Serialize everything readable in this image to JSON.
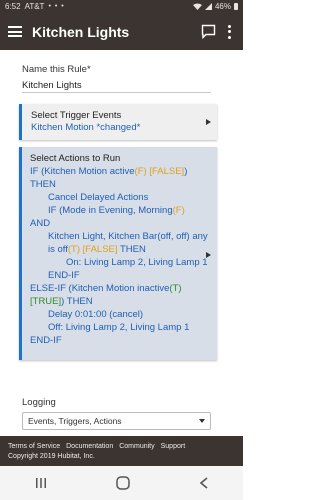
{
  "status_bar": {
    "time": "6:52",
    "carrier": "AT&T",
    "dots": "• • •",
    "battery": "46%"
  },
  "app_bar": {
    "title": "Kitchen Lights"
  },
  "name_field": {
    "label": "Name this Rule*",
    "value": "Kitchen Lights"
  },
  "trigger": {
    "title": "Select Trigger Events",
    "value": "Kitchen Motion *changed*"
  },
  "actions": {
    "title": "Select Actions to Run",
    "l1a": "IF (Kitchen Motion active",
    "l1b": "(F)",
    "l1c": "[FALSE]",
    "l1d": ")",
    "l2": "THEN",
    "l3": "Cancel Delayed Actions",
    "l4a": "IF (Mode in Evening, Morning",
    "l4b": "(F)",
    "l5": "AND",
    "l6a": "Kitchen Light, Kitchen Bar(off, off) any is off",
    "l6b": "(T)",
    "l6c": "[FALSE]",
    "l6d": "THEN",
    "l7": "On: Living Lamp 2, Living Lamp 1",
    "l8": "END-IF",
    "l9a": "ELSE-IF (Kitchen Motion inactive",
    "l9b": "(T)",
    "l10a": "[TRUE]",
    "l10b": ") THEN",
    "l11": "Delay 0:01:00 (cancel)",
    "l12": "Off: Living Lamp 2, Living Lamp 1",
    "l13": "END-IF"
  },
  "logging": {
    "label": "Logging",
    "value": "Events, Triggers, Actions"
  },
  "footer": {
    "links": [
      "Terms of Service",
      "Documentation",
      "Community",
      "Support"
    ],
    "copyright": "Copyright 2019 Hubitat, Inc."
  }
}
